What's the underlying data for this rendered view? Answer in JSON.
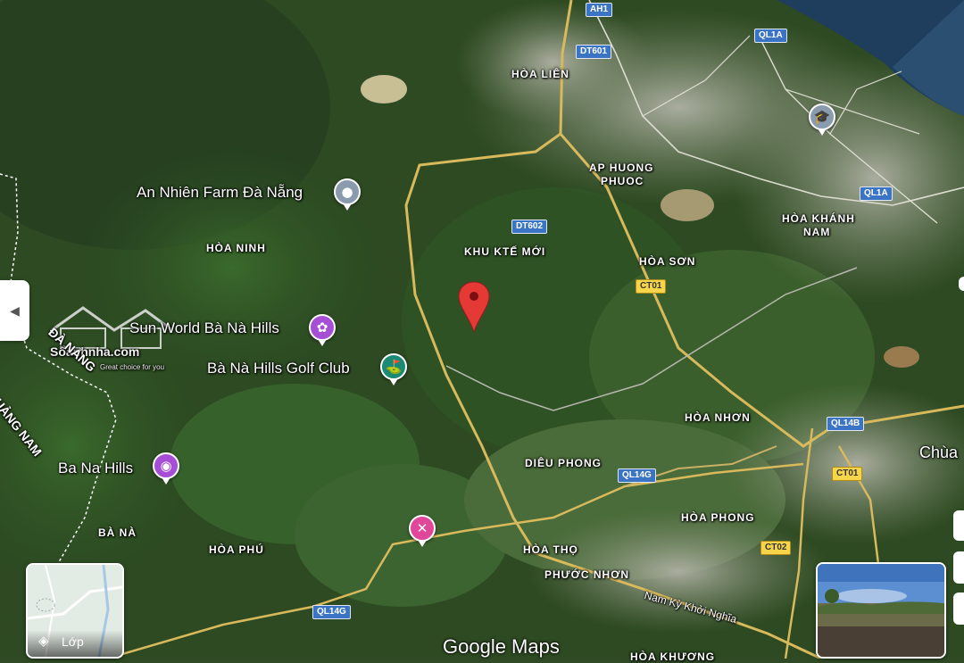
{
  "places": {
    "hoa_lien": "HÒA LIÊN",
    "ap_huong_phuoc_1": "AP HUONG",
    "ap_huong_phuoc_2": "PHUOC",
    "hoa_khanh_nam_1": "HÒA KHÁNH",
    "hoa_khanh_nam_2": "NAM",
    "hoa_ninh": "HÒA NINH",
    "khu_kte_moi": "KHU KTẾ MỚI",
    "hoa_son": "HÒA SƠN",
    "hoa_nhon": "HÒA NHƠN",
    "dieu_phong": "DIÊU PHONG",
    "hoa_phong": "HÒA PHONG",
    "ba_na": "BÀ NÀ",
    "hoa_phu": "HÒA PHÚ",
    "hoa_tho": "HÒA THỌ",
    "phuoc_nhon": "PHƯỚC NHƠN",
    "hoa_khuong": "HÒA KHƯƠNG",
    "chua": "Chùa",
    "quang_nam": "QUẢNG NAM",
    "da_nang": "ĐÀ NẴNG",
    "nam_ky_khoi_nghia": "Nam Kỳ Khởi Nghĩa"
  },
  "pois": {
    "an_nhien": "An Nhiên Farm Đà Nẵng",
    "sun_world": "Sun World Bà Nà Hills",
    "golf": "Bà Nà Hills Golf Club",
    "ba_na_hills": "Ba Na Hills"
  },
  "roads": {
    "ah1": "AH1",
    "dt601": "DT601",
    "ql1a_top": "QL1A",
    "ql1a_mid": "QL1A",
    "dt602": "DT602",
    "ct01_a": "CT01",
    "ct01_b": "CT01",
    "ql14b": "QL14B",
    "ql14g_a": "QL14G",
    "ql14g_b": "QL14G",
    "ct02": "CT02"
  },
  "controls": {
    "layers_label": "Lớp",
    "google_logo": "Google Maps",
    "collapse_icon": "chevron-left-icon"
  },
  "watermark": {
    "name": "Sổanhnha.com",
    "tagline": "Great choice for you"
  },
  "colors": {
    "pin_red": "#e53935",
    "poi_gray": "#8a9bae",
    "poi_purple": "#a64fd6",
    "poi_pink": "#e0479a",
    "poi_teal": "#1a8a75",
    "shield_blue": "#3b74c4",
    "shield_yellow": "#f7d54a"
  }
}
